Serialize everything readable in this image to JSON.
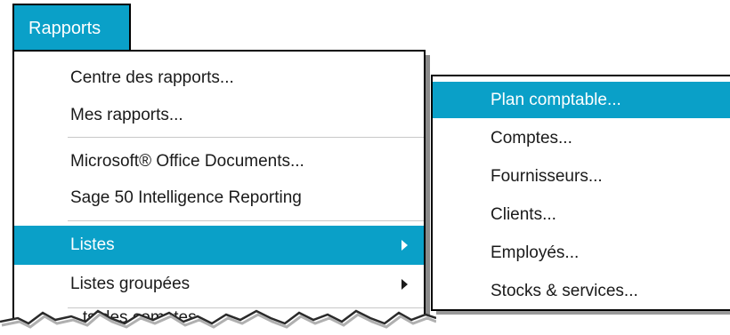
{
  "menubar": {
    "title": "Rapports"
  },
  "menu": {
    "items": [
      {
        "label": "Centre des rapports..."
      },
      {
        "label": "Mes rapports..."
      },
      {
        "label": "Microsoft® Office Documents..."
      },
      {
        "label": "Sage 50 Intelligence Reporting"
      },
      {
        "label": "Listes",
        "has_submenu": true,
        "highlighted": true
      },
      {
        "label": "Listes groupées",
        "has_submenu": true
      },
      {
        "label": "...ts des comptes..."
      }
    ]
  },
  "submenu": {
    "items": [
      {
        "label": "Plan comptable...",
        "highlighted": true
      },
      {
        "label": "Comptes..."
      },
      {
        "label": "Fournisseurs..."
      },
      {
        "label": "Clients..."
      },
      {
        "label": "Employés..."
      },
      {
        "label": "Stocks & services..."
      }
    ]
  },
  "colors": {
    "highlight": "#0aa0c8",
    "text": "#1a1a1a",
    "highlight_text": "#ffffff"
  }
}
